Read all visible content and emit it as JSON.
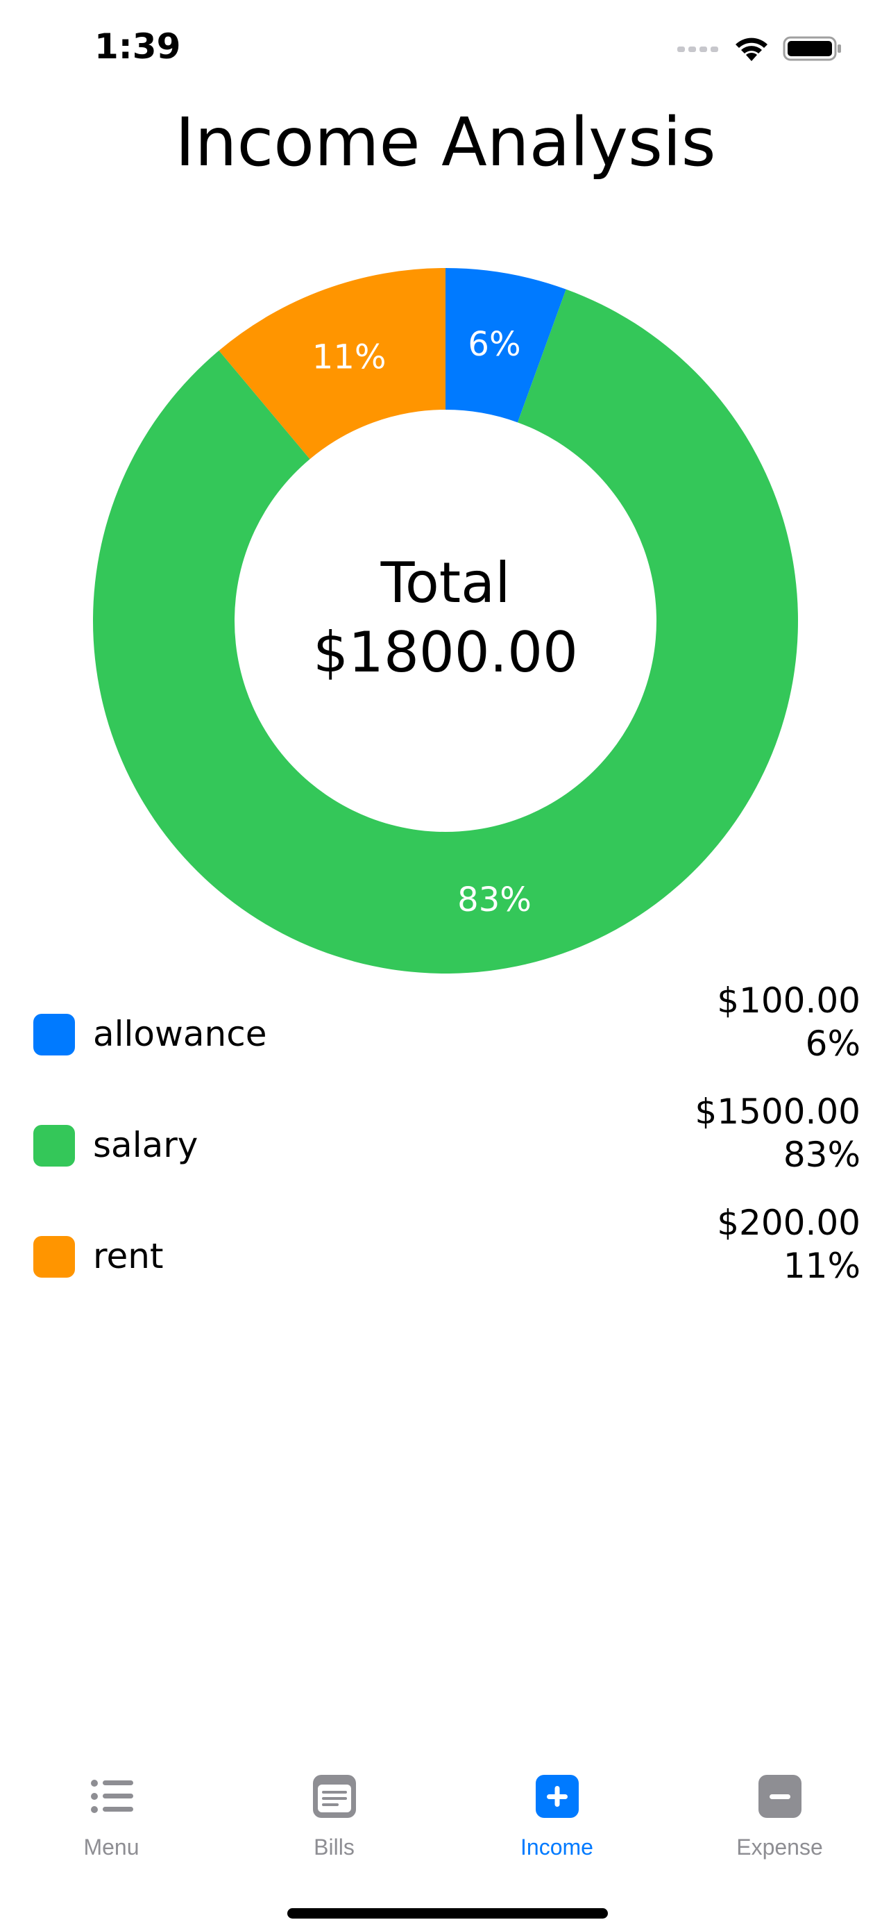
{
  "status_bar": {
    "time": "1:39",
    "icons": [
      "cellular-signal-icon",
      "wifi-icon",
      "battery-icon"
    ]
  },
  "title": "Income Analysis",
  "chart": {
    "center_title": "Total",
    "center_amount": "$1800.00"
  },
  "chart_data": {
    "type": "pie",
    "variant": "donut",
    "categories": [
      "allowance",
      "salary",
      "rent"
    ],
    "values": [
      100,
      1500,
      200
    ],
    "percent_labels": [
      "6%",
      "83%",
      "11%"
    ],
    "colors": [
      "#007AFF",
      "#34C759",
      "#FF9500"
    ],
    "start_angle_deg": 0,
    "direction": "clockwise",
    "title": "Income Analysis"
  },
  "legend": {
    "items": [
      {
        "name": "allowance",
        "amount": "$100.00",
        "percent": "6%",
        "color": "#007AFF"
      },
      {
        "name": "salary",
        "amount": "$1500.00",
        "percent": "83%",
        "color": "#34C759"
      },
      {
        "name": "rent",
        "amount": "$200.00",
        "percent": "11%",
        "color": "#FF9500"
      }
    ]
  },
  "tab_bar": {
    "active_color": "#007AFF",
    "inactive_color": "#8E8E93",
    "tabs": [
      {
        "label": "Menu",
        "icon": "list-icon",
        "active": false
      },
      {
        "label": "Bills",
        "icon": "bills-icon",
        "active": false
      },
      {
        "label": "Income",
        "icon": "plus-square-icon",
        "active": true
      },
      {
        "label": "Expense",
        "icon": "minus-square-icon",
        "active": false
      }
    ]
  }
}
